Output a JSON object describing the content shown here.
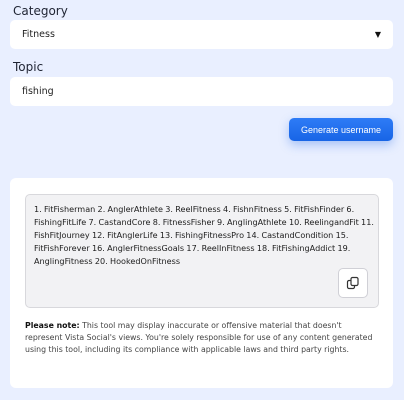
{
  "category": {
    "label": "Category",
    "selected": "Fitness"
  },
  "topic": {
    "label": "Topic",
    "value": "fishing"
  },
  "generate_button": "Generate username",
  "result": {
    "text": "1. FitFisherman 2. AnglerAthlete 3. ReelFitness 4. FishnFitness 5. FitFishFinder 6. FishingFitLife 7. CastandCore 8. FitnessFisher 9. AnglingAthlete 10. ReelingandFit 11. FishFitJourney 12. FitAnglerLife 13. FishingFitnessPro 14. CastandCondition 15. FitFishForever 16. AnglerFitnessGoals 17. ReelInFitness 18. FitFishingAddict 19. AnglingFitness 20. HookedOnFitness"
  },
  "note": {
    "title": "Please note:",
    "body": " This tool may display inaccurate or offensive material that doesn't represent Vista Social's views. You're solely responsible for use of any content generated using this tool, including its compliance with applicable laws and third party rights."
  },
  "colors": {
    "background": "#e9efff",
    "accent": "#1f6ff0"
  }
}
